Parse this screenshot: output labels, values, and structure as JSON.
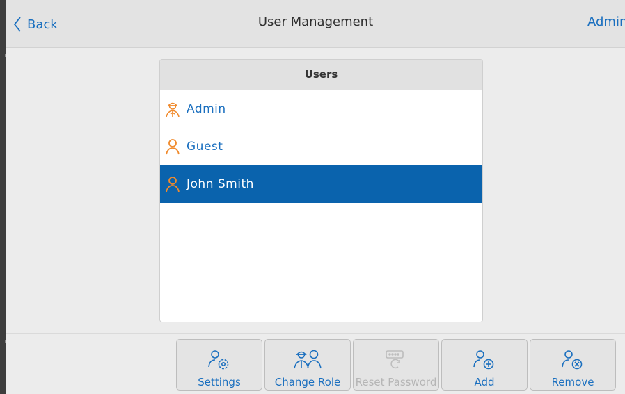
{
  "header": {
    "back_label": "Back",
    "title": "User Management",
    "current_user": "Admin"
  },
  "users_panel": {
    "heading": "Users",
    "items": [
      {
        "label": "Admin",
        "icon": "admin-user-icon",
        "selected": false
      },
      {
        "label": "Guest",
        "icon": "user-icon",
        "selected": false
      },
      {
        "label": "John Smith",
        "icon": "user-icon",
        "selected": true
      }
    ]
  },
  "toolbar": {
    "buttons": [
      {
        "label": "Settings",
        "icon": "user-settings-icon",
        "enabled": true
      },
      {
        "label": "Change Role",
        "icon": "change-role-icon",
        "enabled": true
      },
      {
        "label": "Reset Password",
        "icon": "reset-password-icon",
        "enabled": false
      },
      {
        "label": "Add",
        "icon": "add-user-icon",
        "enabled": true
      },
      {
        "label": "Remove",
        "icon": "remove-user-icon",
        "enabled": true
      }
    ]
  },
  "colors": {
    "accent": "#1a6fbf",
    "selection": "#0a63ad",
    "user_icon": "#f08a2c",
    "disabled": "#b5b5b5"
  }
}
